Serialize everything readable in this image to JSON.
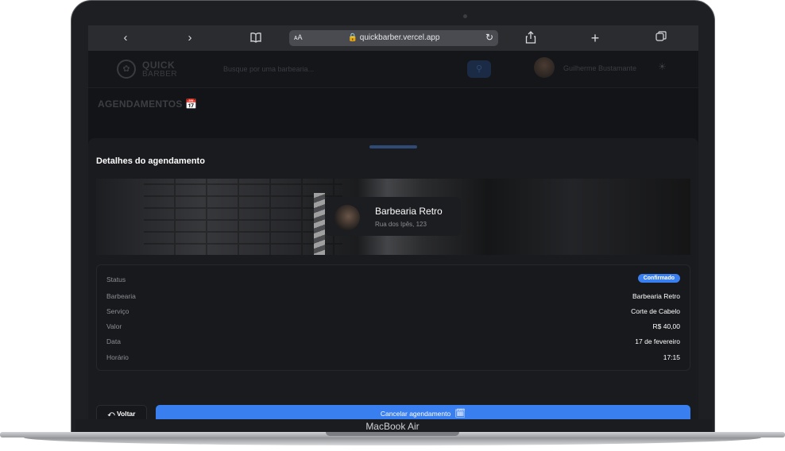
{
  "browser": {
    "text_size_label": "ᴀA",
    "url": "quickbarber.vercel.app",
    "icons": [
      "back-icon",
      "forward-icon",
      "bookmarks-icon",
      "lock-icon",
      "reload-icon",
      "share-icon",
      "new-tab-icon",
      "tabs-icon"
    ]
  },
  "header": {
    "logo_line1": "QUICK",
    "logo_line2": "BARBER",
    "search_placeholder": "Busque por uma barbearia...",
    "user_name": "Guilherme Bustamante"
  },
  "section_title": "AGENDAMENTOS",
  "sheet": {
    "title": "Detalhes do agendamento",
    "barbershop_name": "Barbearia Retro",
    "barbershop_address": "Rua dos Ipês, 123",
    "details": [
      {
        "label": "Status",
        "value": "Confirmado",
        "type": "badge"
      },
      {
        "label": "Barbearia",
        "value": "Barbearia Retro"
      },
      {
        "label": "Serviço",
        "value": "Corte de Cabelo"
      },
      {
        "label": "Valor",
        "value": "R$ 40,00"
      },
      {
        "label": "Data",
        "value": "17 de fevereiro"
      },
      {
        "label": "Horário",
        "value": "17:15"
      }
    ],
    "back_label": "Voltar",
    "cancel_label": "Cancelar agendamento"
  },
  "device_label": "MacBook Air",
  "colors": {
    "accent": "#3a7ff0",
    "background": "#1a1b1f"
  }
}
